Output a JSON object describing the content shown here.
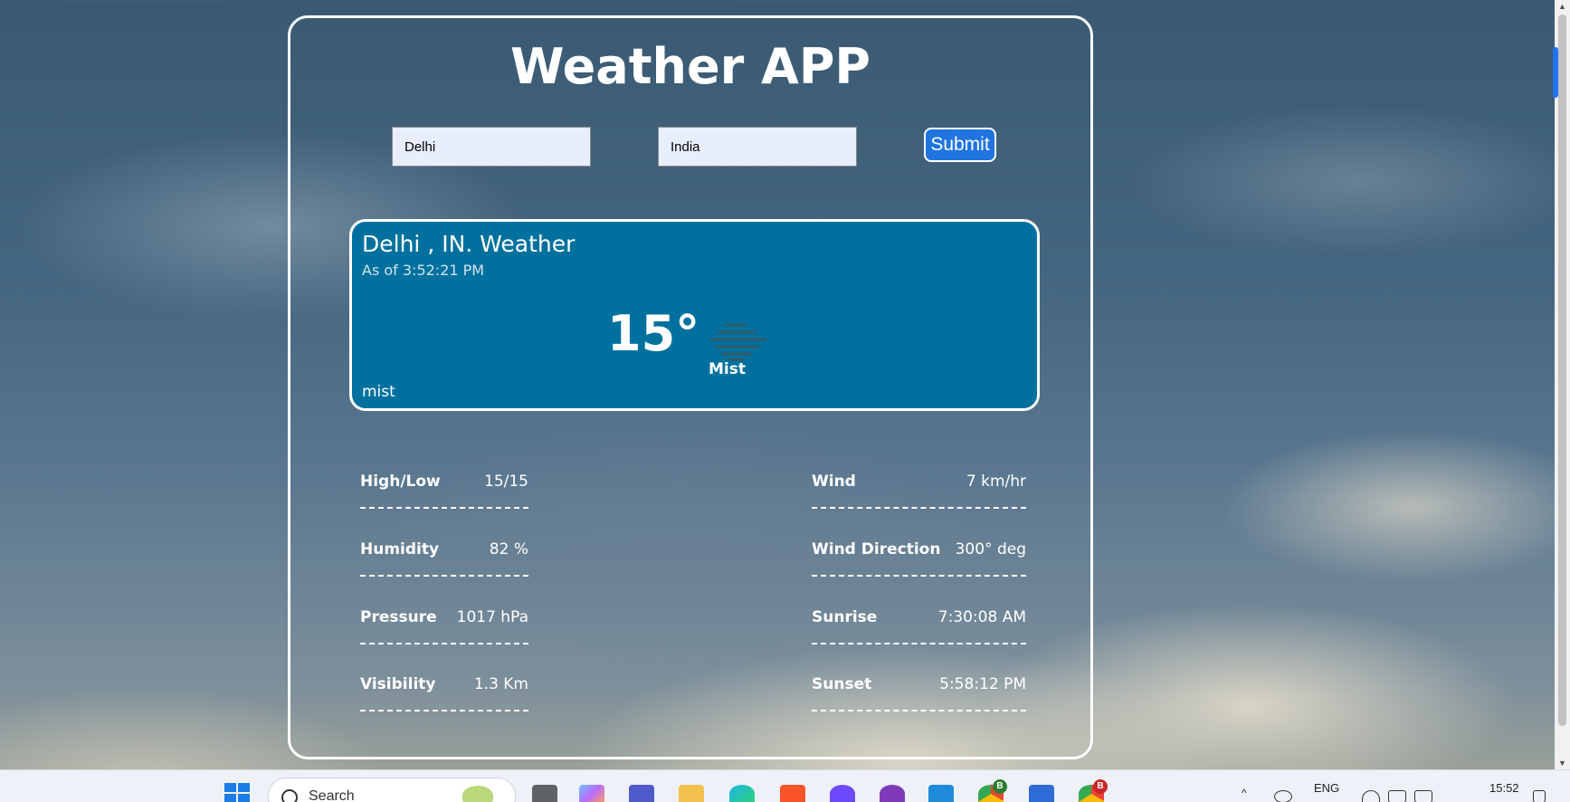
{
  "app": {
    "title": "Weather APP",
    "city_input_value": "Delhi",
    "country_input_value": "India",
    "submit_label": "Submit"
  },
  "current": {
    "heading": "Delhi , IN. Weather",
    "as_of": "As of 3:52:21 PM",
    "temperature": "15°",
    "condition_main": "Mist",
    "condition_desc": "mist",
    "icon": "mist-icon"
  },
  "details": {
    "left": [
      {
        "label": "High/Low",
        "value": "15/15"
      },
      {
        "label": "Humidity",
        "value": "82 %"
      },
      {
        "label": "Pressure",
        "value": "1017 hPa"
      },
      {
        "label": "Visibility",
        "value": "1.3 Km"
      }
    ],
    "right": [
      {
        "label": "Wind",
        "value": "7 km/hr"
      },
      {
        "label": "Wind Direction",
        "value": "300° deg"
      },
      {
        "label": "Sunrise",
        "value": "7:30:08 AM"
      },
      {
        "label": "Sunset",
        "value": "5:58:12 PM"
      }
    ]
  },
  "taskbar": {
    "search_label": "Search",
    "language": "ENG",
    "time": "15:52",
    "badges": [
      "B",
      "B"
    ],
    "icons": [
      "windows-start-icon",
      "search-icon",
      "copilot-icon",
      "teams-icon",
      "file-explorer-icon",
      "edge-icon",
      "brave-icon",
      "proton-vpn-icon",
      "github-desktop-icon",
      "vscode-icon",
      "chrome-icon",
      "paint-icon",
      "chrome-profile-icon",
      "wifi-icon",
      "volume-icon",
      "battery-icon"
    ]
  },
  "colors": {
    "panel": "#00719e",
    "submit": "#1f74e0",
    "accent": "#1f74ff"
  }
}
